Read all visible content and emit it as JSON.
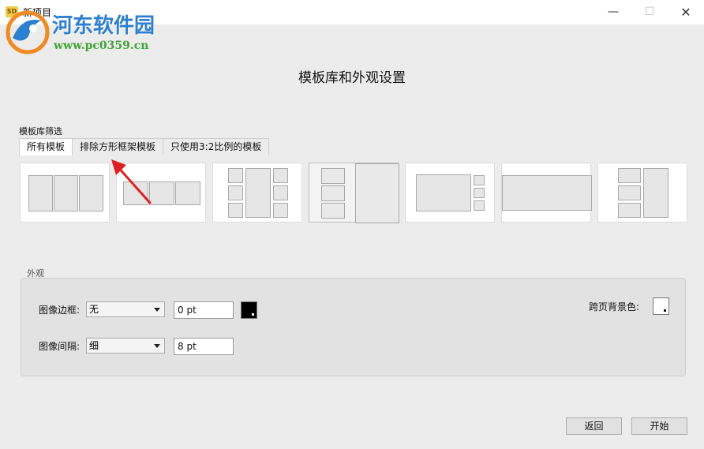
{
  "window": {
    "title": "新项目",
    "app_icon": "SD",
    "buttons": {
      "minimize": "—",
      "maximize": "☐",
      "close": "✕"
    }
  },
  "watermark": {
    "title": "河东软件园",
    "url": "www.pc0359.cn"
  },
  "heading": "模板库和外观设置",
  "filter": {
    "label": "模板库筛选",
    "tabs": [
      {
        "label": "所有模板",
        "active": true
      },
      {
        "label": "排除方形框架模板",
        "active": false
      },
      {
        "label": "只使用3:2比例的模板",
        "active": false
      }
    ]
  },
  "templates": [
    {
      "name": "three-columns",
      "selected": false
    },
    {
      "name": "three-small-row",
      "selected": false
    },
    {
      "name": "six-small-around-tall",
      "selected": false
    },
    {
      "name": "three-stack-with-large",
      "selected": true
    },
    {
      "name": "large-with-three-stack",
      "selected": false
    },
    {
      "name": "single-wide",
      "selected": false
    },
    {
      "name": "three-stack-with-tall",
      "selected": false
    }
  ],
  "appearance": {
    "label": "外观",
    "border_label": "图像边框:",
    "border_style": "无",
    "border_width": "0 pt",
    "border_color": "#000000",
    "spacing_label": "图像间隔:",
    "spacing_style": "细",
    "spacing_width": "8 pt",
    "bg_label": "跨页背景色:",
    "bg_color": "#ffffff"
  },
  "footer": {
    "back": "返回",
    "start": "开始"
  },
  "colors": {
    "annotation_arrow": "#e02020",
    "watermark_title": "#2d7fd0",
    "watermark_url": "#3fa535"
  }
}
